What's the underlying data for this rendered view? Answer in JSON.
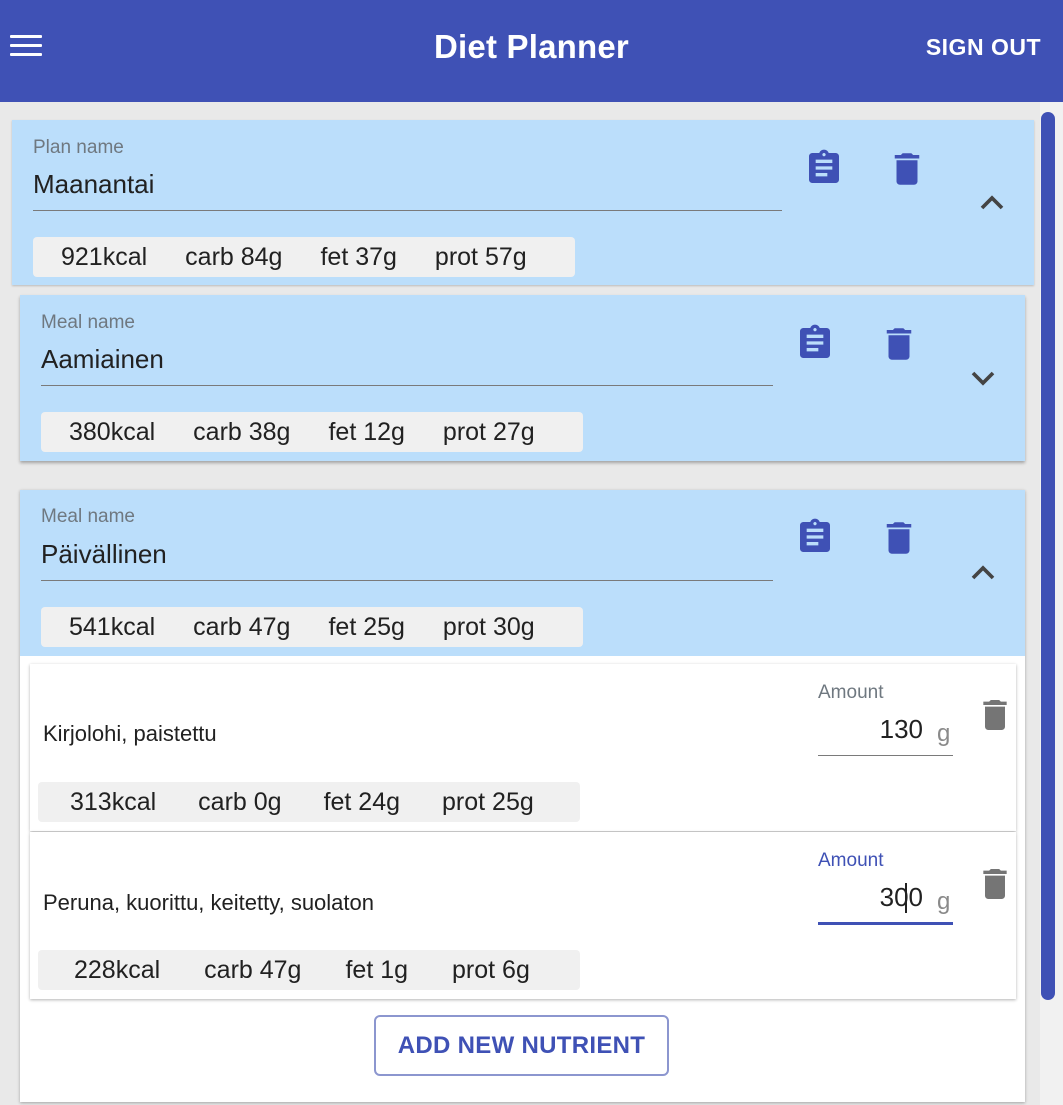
{
  "app": {
    "title": "Diet Planner",
    "sign_out_label": "SIGN OUT"
  },
  "plan": {
    "label": "Plan name",
    "value": "Maanantai",
    "stats": {
      "kcal": "921kcal",
      "carb": "carb 84g",
      "fat": "fet 37g",
      "prot": "prot 57g"
    },
    "expanded": true
  },
  "meals": [
    {
      "label": "Meal name",
      "value": "Aamiainen",
      "stats": {
        "kcal": "380kcal",
        "carb": "carb 38g",
        "fat": "fet 12g",
        "prot": "prot 27g"
      },
      "expanded": false
    },
    {
      "label": "Meal name",
      "value": "Päivällinen",
      "stats": {
        "kcal": "541kcal",
        "carb": "carb 47g",
        "fat": "fet 25g",
        "prot": "prot 30g"
      },
      "expanded": true,
      "nutrients": [
        {
          "name": "Kirjolohi, paistettu",
          "amount_label": "Amount",
          "amount": "130",
          "unit": "g",
          "stats": {
            "kcal": "313kcal",
            "carb": "carb 0g",
            "fat": "fet 24g",
            "prot": "prot 25g"
          }
        },
        {
          "name": "Peruna, kuorittu, keitetty, suolaton",
          "amount_label": "Amount",
          "amount": "300",
          "unit": "g",
          "focused": true,
          "stats": {
            "kcal": "228kcal",
            "carb": "carb 47g",
            "fat": "fet 1g",
            "prot": "prot 6g"
          }
        }
      ],
      "add_button_label": "ADD NEW NUTRIENT"
    }
  ],
  "icons": {
    "menu": "menu-icon",
    "copy": "clipboard-icon",
    "delete": "trash-icon",
    "expand": "chevron-down-icon",
    "collapse": "chevron-up-icon"
  },
  "colors": {
    "primary": "#3f51b5",
    "card_header": "#bbdefb",
    "chip_bg": "#f0f0f0",
    "nutrient_trash": "#757575"
  }
}
